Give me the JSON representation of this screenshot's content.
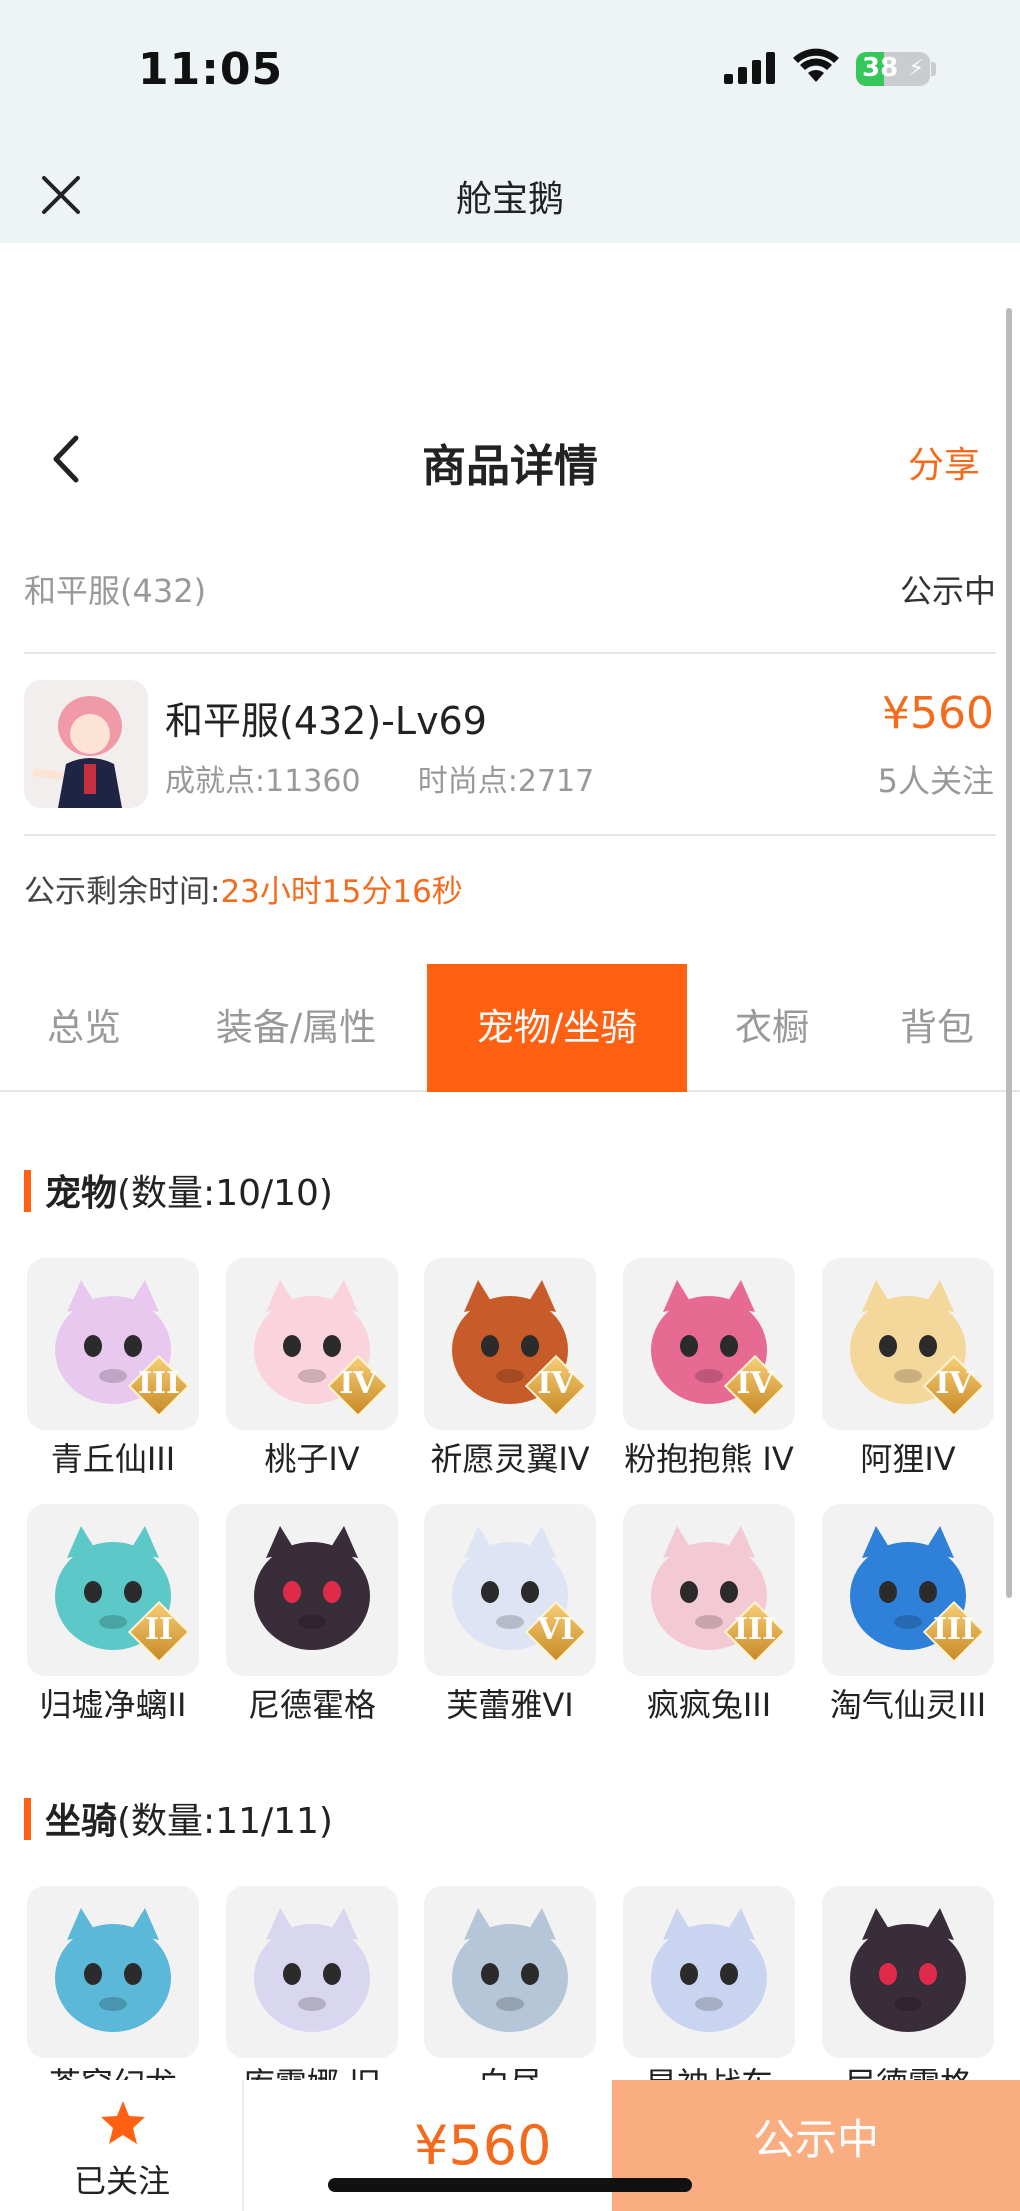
{
  "status_bar": {
    "time": "11:05",
    "battery": "38",
    "battery_level": 0.38
  },
  "app_bar": {
    "title": "舱宝鹅"
  },
  "page_header": {
    "title": "商品详情",
    "share_label": "分享"
  },
  "server": {
    "name": "和平服(432)",
    "status": "公示中"
  },
  "item": {
    "name": "和平服(432)-Lv69",
    "achievement": "成就点:11360",
    "fashion": "时尚点:2717",
    "price": "¥560",
    "follows": "5人关注"
  },
  "timer": {
    "label": "公示剩余时间:",
    "value": "23小时15分16秒"
  },
  "tabs": [
    "总览",
    "装备/属性",
    "宠物/坐骑",
    "衣橱",
    "背包"
  ],
  "active_tab": "宠物/坐骑",
  "pets": {
    "title": "宠物",
    "count": "(数量:10/10)",
    "items": [
      {
        "name": "青丘仙III",
        "tier": "III",
        "color": "#e9c8f0",
        "icon": "fox-spirit-icon"
      },
      {
        "name": "桃子IV",
        "tier": "IV",
        "color": "#fbd3dc",
        "icon": "bunny-icon"
      },
      {
        "name": "祈愿灵翼IV",
        "tier": "IV",
        "color": "#c85b2a",
        "icon": "eagle-icon"
      },
      {
        "name": "粉抱抱熊 IV",
        "tier": "IV",
        "color": "#e76a93",
        "icon": "bear-icon"
      },
      {
        "name": "阿狸IV",
        "tier": "IV",
        "color": "#f4d79a",
        "icon": "lion-hat-icon"
      },
      {
        "name": "归墟净螭II",
        "tier": "II",
        "color": "#5cc8c8",
        "icon": "dragon-icon"
      },
      {
        "name": "尼德霍格",
        "tier": "",
        "color": "#3a2d3a",
        "icon": "dark-dragon-icon"
      },
      {
        "name": "芙蕾雅VI",
        "tier": "VI",
        "color": "#dfe4f4",
        "icon": "goddess-icon"
      },
      {
        "name": "疯疯兔III",
        "tier": "III",
        "color": "#f3c9d4",
        "icon": "rabbit-icon"
      },
      {
        "name": "淘气仙灵III",
        "tier": "III",
        "color": "#2f80d8",
        "icon": "blue-dog-icon"
      }
    ]
  },
  "mounts": {
    "title": "坐骑",
    "count": "(数量:11/11)",
    "items": [
      {
        "name": "苍穹幻龙",
        "color": "#5bb8d8",
        "icon": "sky-dragon-icon"
      },
      {
        "name": "库露娜·旧",
        "color": "#d9d6ef",
        "icon": "moon-maiden-icon"
      },
      {
        "name": "白昼",
        "color": "#b5c6d8",
        "icon": "white-cat-icon"
      },
      {
        "name": "星神战车",
        "color": "#c9d4f0",
        "icon": "star-horse-icon"
      },
      {
        "name": "尼德霍格",
        "color": "#3a2d3a",
        "icon": "dark-dragon-icon"
      }
    ]
  },
  "bottom": {
    "fav_label": "已关注",
    "price": "¥560",
    "cta": "公示中"
  },
  "colors": {
    "accent": "#ff6012",
    "price": "#f36b1c",
    "cta_bg": "#fbad82"
  }
}
